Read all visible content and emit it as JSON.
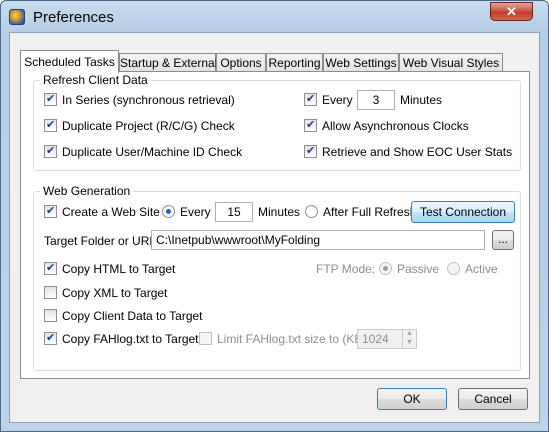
{
  "window": {
    "title": "Preferences",
    "close_label": "✕"
  },
  "tabs": [
    "Scheduled Tasks",
    "Startup & External",
    "Options",
    "Reporting",
    "Web Settings",
    "Web Visual Styles"
  ],
  "refresh": {
    "title": "Refresh Client Data",
    "in_series": "In Series (synchronous retrieval)",
    "duplicate_project": "Duplicate Project (R/C/G) Check",
    "duplicate_user": "Duplicate User/Machine ID Check",
    "every_label": "Every",
    "every_value": "3",
    "minutes_label": "Minutes",
    "allow_async": "Allow Asynchronous Clocks",
    "retrieve_eoc": "Retrieve and Show EOC User Stats"
  },
  "web": {
    "title": "Web Generation",
    "create_site": "Create a Web Site",
    "every_label": "Every",
    "every_value": "15",
    "minutes_label": "Minutes",
    "after_full_refresh": "After Full Refresh",
    "test_connection": "Test Connection",
    "target_label": "Target Folder or URL:",
    "target_value": "C:\\Inetpub\\wwwroot\\MyFolding",
    "browse": "...",
    "copy_html": "Copy HTML to Target",
    "ftp_mode_label": "FTP Mode:",
    "passive": "Passive",
    "active": "Active",
    "copy_xml": "Copy XML to Target",
    "copy_client": "Copy Client Data to Target",
    "copy_fahlog": "Copy FAHlog.txt to Target",
    "limit_label": "Limit FAHlog.txt size to (KB):",
    "limit_value": "1024"
  },
  "footer": {
    "ok": "OK",
    "cancel": "Cancel"
  }
}
